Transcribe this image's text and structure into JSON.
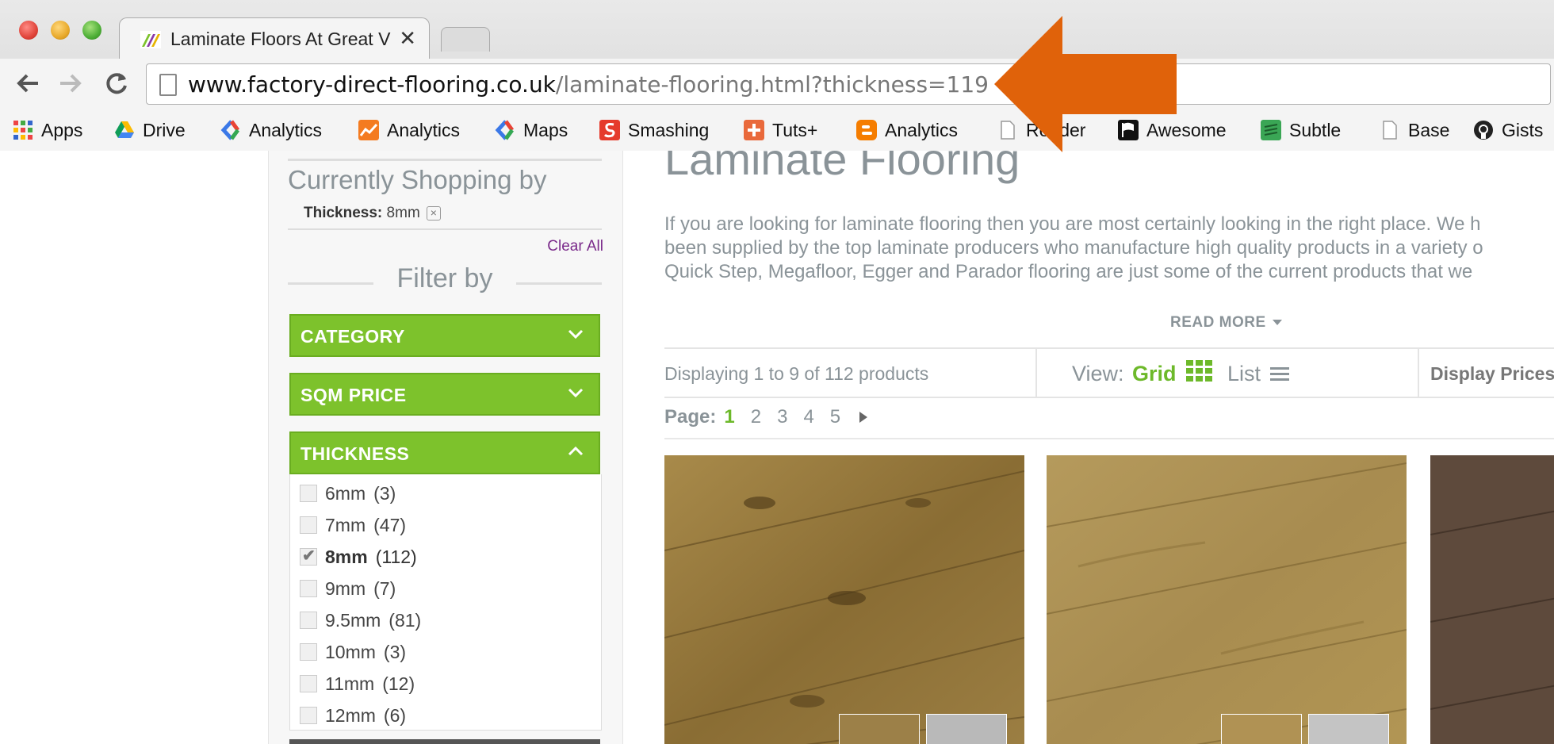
{
  "browser": {
    "tab_title": "Laminate Floors At Great V",
    "url_domain": "www.factory-direct-flooring.co.uk",
    "url_path": "/laminate-flooring.html?thickness=119",
    "bookmarks": [
      {
        "label": "Apps",
        "icon": "apps-grid-icon"
      },
      {
        "label": "Drive",
        "icon": "drive-icon"
      },
      {
        "label": "Analytics",
        "icon": "analytics-icon"
      },
      {
        "label": "Analytics",
        "icon": "chart-icon"
      },
      {
        "label": "Maps",
        "icon": "maps-icon"
      },
      {
        "label": "Smashing",
        "icon": "smashing-icon"
      },
      {
        "label": "Tuts+",
        "icon": "tuts-icon"
      },
      {
        "label": "Analytics",
        "icon": "blogger-icon"
      },
      {
        "label": "Reader",
        "icon": "page-icon"
      },
      {
        "label": "Awesome",
        "icon": "flag-icon"
      },
      {
        "label": "Subtle",
        "icon": "subtle-icon"
      },
      {
        "label": "Base",
        "icon": "page-icon"
      },
      {
        "label": "Gists",
        "icon": "github-icon"
      }
    ]
  },
  "sidebar": {
    "currently_title": "Currently Shopping by",
    "active_filter_label": "Thickness:",
    "active_filter_value": "8mm",
    "clear_all": "Clear All",
    "filter_by": "Filter by",
    "accordions": [
      {
        "label": "CATEGORY",
        "expanded": false
      },
      {
        "label": "SQM PRICE",
        "expanded": false
      },
      {
        "label": "THICKNESS",
        "expanded": true
      }
    ],
    "thickness_options": [
      {
        "label": "6mm",
        "count": "(3)",
        "checked": false
      },
      {
        "label": "7mm",
        "count": "(47)",
        "checked": false
      },
      {
        "label": "8mm",
        "count": "(112)",
        "checked": true
      },
      {
        "label": "9mm",
        "count": "(7)",
        "checked": false
      },
      {
        "label": "9.5mm",
        "count": "(81)",
        "checked": false
      },
      {
        "label": "10mm",
        "count": "(3)",
        "checked": false
      },
      {
        "label": "11mm",
        "count": "(12)",
        "checked": false
      },
      {
        "label": "12mm",
        "count": "(6)",
        "checked": false
      }
    ]
  },
  "main": {
    "title": "Laminate Flooring",
    "description": "If you are looking for laminate flooring then you are most certainly looking in the right place. We h\nbeen supplied by the top laminate producers who manufacture high quality products in a variety o\nQuick Step, Megafloor, Egger and Parador flooring are just some of the current products that we",
    "read_more": "READ MORE",
    "displaying": "Displaying 1 to 9 of 112 products",
    "view_label": "View:",
    "view_grid": "Grid",
    "view_list": "List",
    "display_prices": "Display Prices",
    "page_label": "Page:",
    "pages": [
      "1",
      "2",
      "3",
      "4",
      "5"
    ],
    "current_page": "1"
  },
  "colors": {
    "accent_green": "#7dc22c",
    "annotation_orange": "#e0620a"
  }
}
